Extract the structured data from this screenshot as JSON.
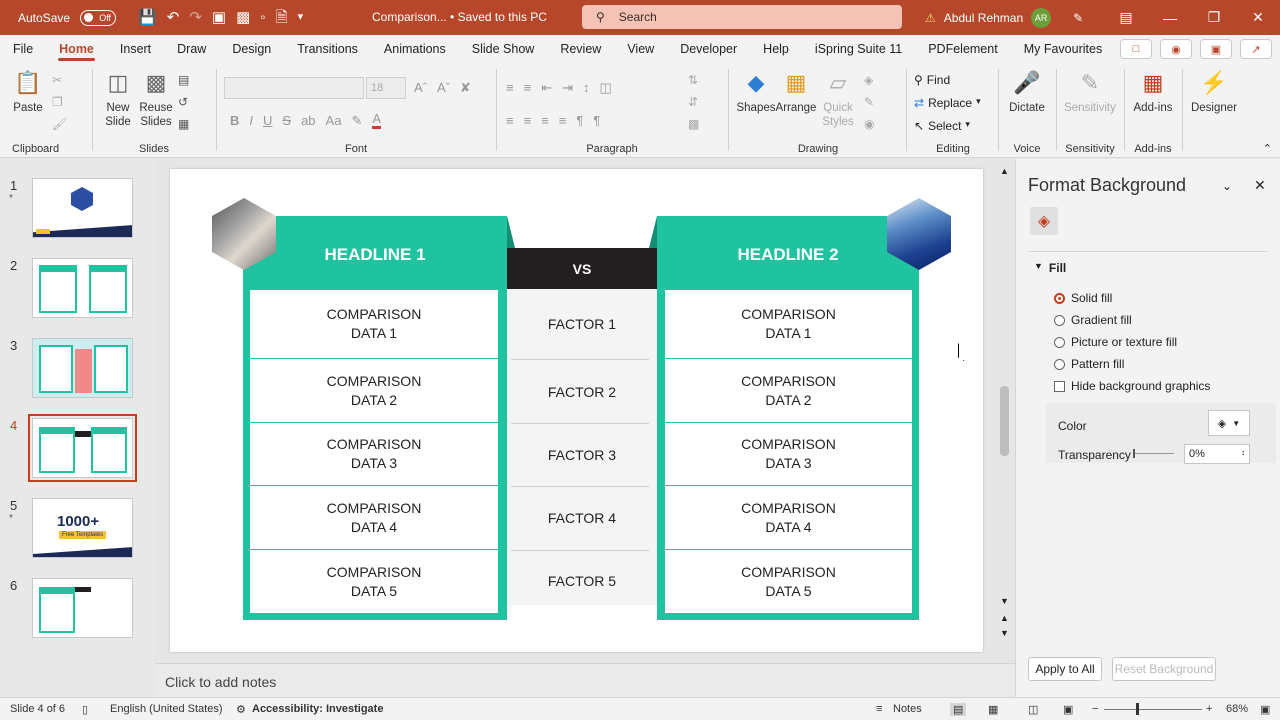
{
  "app": {
    "autosave_label": "AutoSave",
    "autosave_state": "Off",
    "doc_title": "Comparison... • Saved to this PC",
    "search_placeholder": "Search",
    "user_name": "Abdul Rehman",
    "user_initials": "AR"
  },
  "menu": {
    "tabs": [
      "File",
      "Home",
      "Insert",
      "Draw",
      "Design",
      "Transitions",
      "Animations",
      "Slide Show",
      "Review",
      "View",
      "Developer",
      "Help",
      "iSpring Suite 11",
      "PDFelement",
      "My Favourites"
    ],
    "active": "Home"
  },
  "ribbon": {
    "clipboard": {
      "paste": "Paste",
      "label": "Clipboard"
    },
    "slides": {
      "new_slide": "New",
      "new_slide2": "Slide",
      "reuse": "Reuse",
      "reuse2": "Slides",
      "label": "Slides"
    },
    "font": {
      "label": "Font",
      "size": "18"
    },
    "paragraph": {
      "label": "Paragraph"
    },
    "drawing": {
      "shapes": "Shapes",
      "arrange": "Arrange",
      "quick": "Quick",
      "quick2": "Styles",
      "label": "Drawing"
    },
    "editing": {
      "find": "Find",
      "replace": "Replace",
      "select": "Select",
      "label": "Editing"
    },
    "voice": {
      "dictate": "Dictate",
      "label": "Voice"
    },
    "sensitivity": {
      "btn": "Sensitivity",
      "label": "Sensitivity"
    },
    "addins": {
      "btn": "Add-ins",
      "label": "Add-ins"
    },
    "designer": {
      "btn": "Designer"
    }
  },
  "thumbnails": [
    {
      "num": "1",
      "star": "*"
    },
    {
      "num": "2",
      "star": ""
    },
    {
      "num": "3",
      "star": ""
    },
    {
      "num": "4",
      "star": ""
    },
    {
      "num": "5",
      "star": "*"
    },
    {
      "num": "6",
      "star": ""
    }
  ],
  "thumb5_text": {
    "big": "1000+",
    "sub": "Free Templates"
  },
  "slide": {
    "headline1": "HEADLINE 1",
    "headline2": "HEADLINE 2",
    "vs": "VS",
    "left_rows": [
      [
        "COMPARISON",
        "DATA 1"
      ],
      [
        "COMPARISON",
        "DATA 2"
      ],
      [
        "COMPARISON",
        "DATA 3"
      ],
      [
        "COMPARISON",
        "DATA 4"
      ],
      [
        "COMPARISON",
        "DATA 5"
      ]
    ],
    "factors": [
      "FACTOR 1",
      "FACTOR 2",
      "FACTOR 3",
      "FACTOR 4",
      "FACTOR 5"
    ],
    "right_rows": [
      [
        "COMPARISON",
        "DATA 1"
      ],
      [
        "COMPARISON",
        "DATA 2"
      ],
      [
        "COMPARISON",
        "DATA 3"
      ],
      [
        "COMPARISON",
        "DATA 4"
      ],
      [
        "COMPARISON",
        "DATA 5"
      ]
    ],
    "accent": "#1fc3a0",
    "dark": "#231f20"
  },
  "notes": "Click to add notes",
  "pane": {
    "title": "Format Background",
    "section": "Fill",
    "options": [
      "Solid fill",
      "Gradient fill",
      "Picture or texture fill",
      "Pattern fill"
    ],
    "hide_bg": "Hide background graphics",
    "color_label": "Color",
    "transparency_label": "Transparency",
    "transparency_value": "0%",
    "apply_all": "Apply to All",
    "reset": "Reset Background"
  },
  "status": {
    "slide": "Slide 4 of 6",
    "lang": "English (United States)",
    "access": "Accessibility: Investigate",
    "notes": "Notes",
    "zoom": "68%"
  }
}
